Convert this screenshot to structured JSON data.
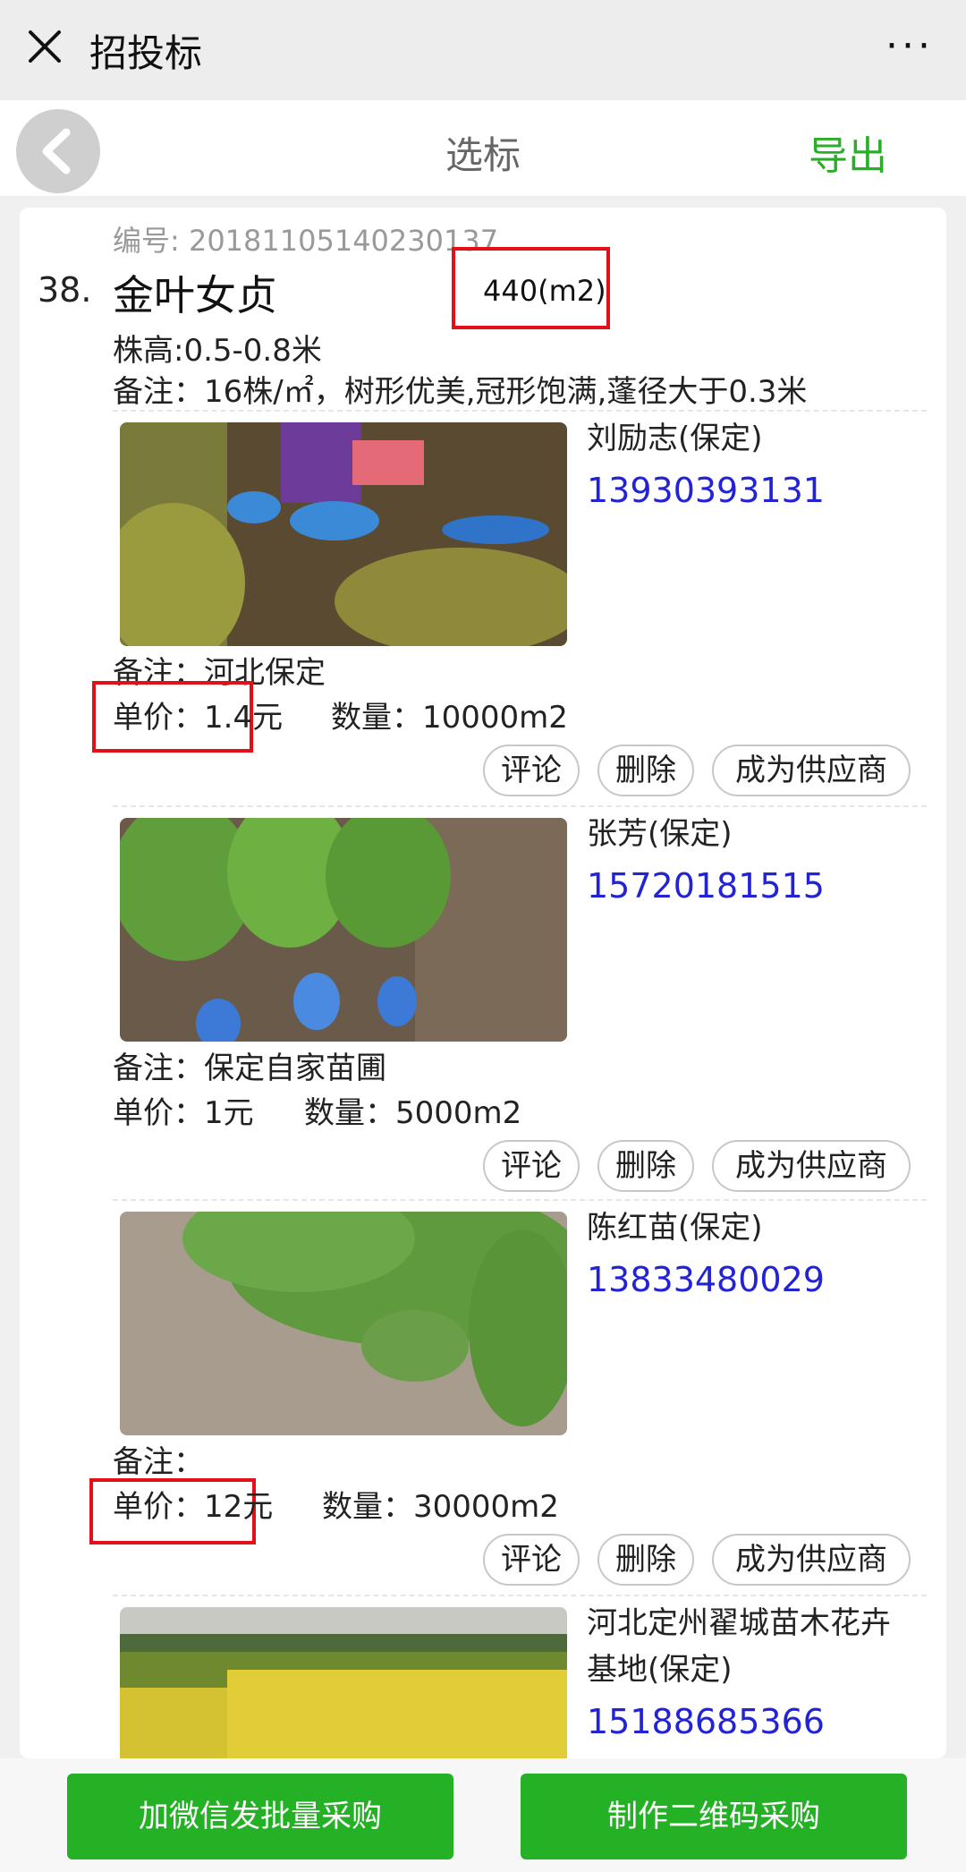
{
  "topbar": {
    "title": "招投标",
    "more": "···"
  },
  "navbar": {
    "title": "选标",
    "export": "导出"
  },
  "product": {
    "item_no": "编号: 20181105140230137",
    "index": "38.",
    "name": "金叶女贞",
    "quantity": "440(m2)",
    "height": "株高:0.5-0.8米",
    "remark": "备注：16株/㎡，树形优美,冠形饱满,蓬径大于0.3米"
  },
  "bids": [
    {
      "supplier": "刘励志(保定)",
      "phone": "13930393131",
      "remark": "备注：河北保定",
      "price": "单价：1.4元",
      "amount": "数量：10000m2"
    },
    {
      "supplier": "张芳(保定)",
      "phone": "15720181515",
      "remark": "备注：保定自家苗圃",
      "price": "单价：1元",
      "amount": "数量：5000m2"
    },
    {
      "supplier": "陈红苗(保定)",
      "phone": "13833480029",
      "remark": "备注：",
      "price": "单价：12元",
      "amount": "数量：30000m2"
    },
    {
      "supplier": "河北定州翟城苗木花卉基地(保定)",
      "phone": "15188685366"
    }
  ],
  "actions": {
    "comment": "评论",
    "delete": "删除",
    "become_supplier": "成为供应商"
  },
  "bottom": {
    "wechat_bulk": "加微信发批量采购",
    "qrcode": "制作二维码采购"
  }
}
